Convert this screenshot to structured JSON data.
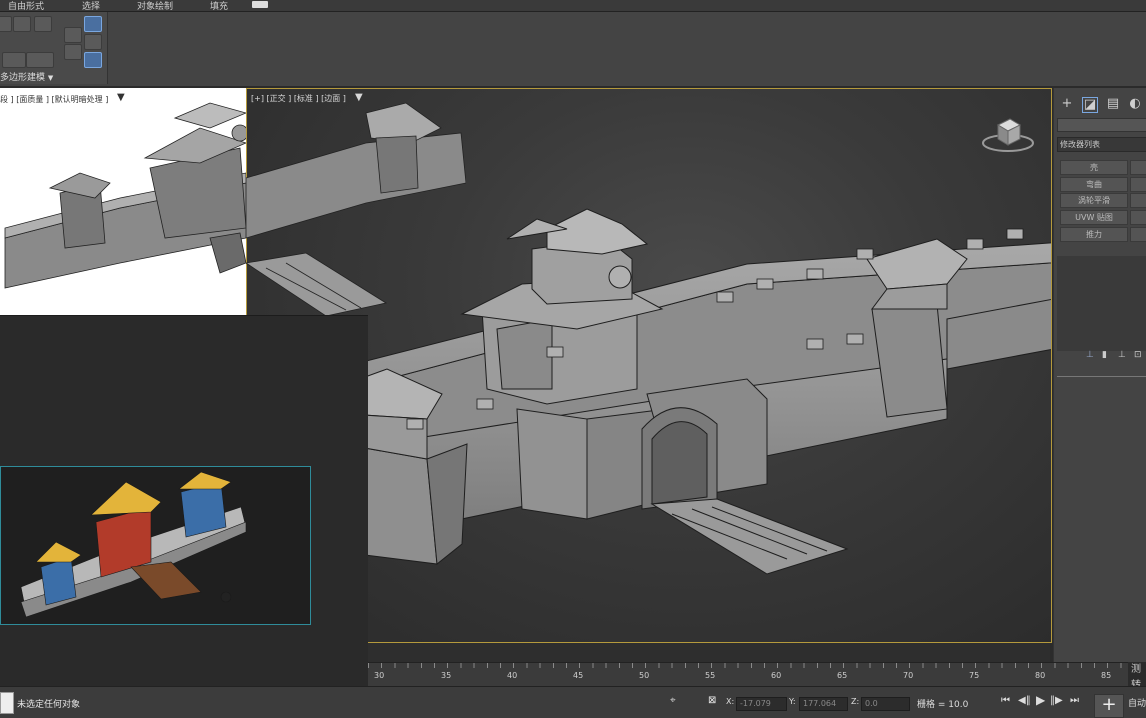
{
  "menu": {
    "items": [
      "自由形式",
      "选择",
      "对象绘制",
      "填充"
    ],
    "extra_icon": "camera-dropdown-icon"
  },
  "ribbon": {
    "panel_title": "多边形建模"
  },
  "viewports": {
    "left_label": "段 ] [面质量 ] [默认明暗处理 ]",
    "persp_label": "[+] [正交 ] [标准 ] [边面 ]"
  },
  "command_panel": {
    "tabs": [
      "create-icon",
      "modify-icon",
      "hierarchy-icon",
      "motion-icon"
    ],
    "modifier_list": "修改器列表",
    "buttons": [
      "壳",
      "弯曲",
      "涡轮平滑",
      "UVW 贴图",
      "推力"
    ]
  },
  "timeline": {
    "ticks": [
      "30",
      "35",
      "40",
      "45",
      "50",
      "55",
      "60",
      "65",
      "70",
      "75",
      "80",
      "85"
    ],
    "side_labels": [
      "测",
      "转"
    ]
  },
  "status": {
    "message": "未选定任何对象",
    "x_label": "X:",
    "x_value": "-17.079",
    "y_label": "Y:",
    "y_value": "177.064",
    "z_label": "Z:",
    "z_value": "0.0",
    "grid_label": "栅格 = 10.0",
    "auto_label": "自动"
  },
  "colors": {
    "viewport_border": "#b59a3c",
    "inset_border": "#2f8c9a",
    "active_tool": "#4a6fa0"
  }
}
